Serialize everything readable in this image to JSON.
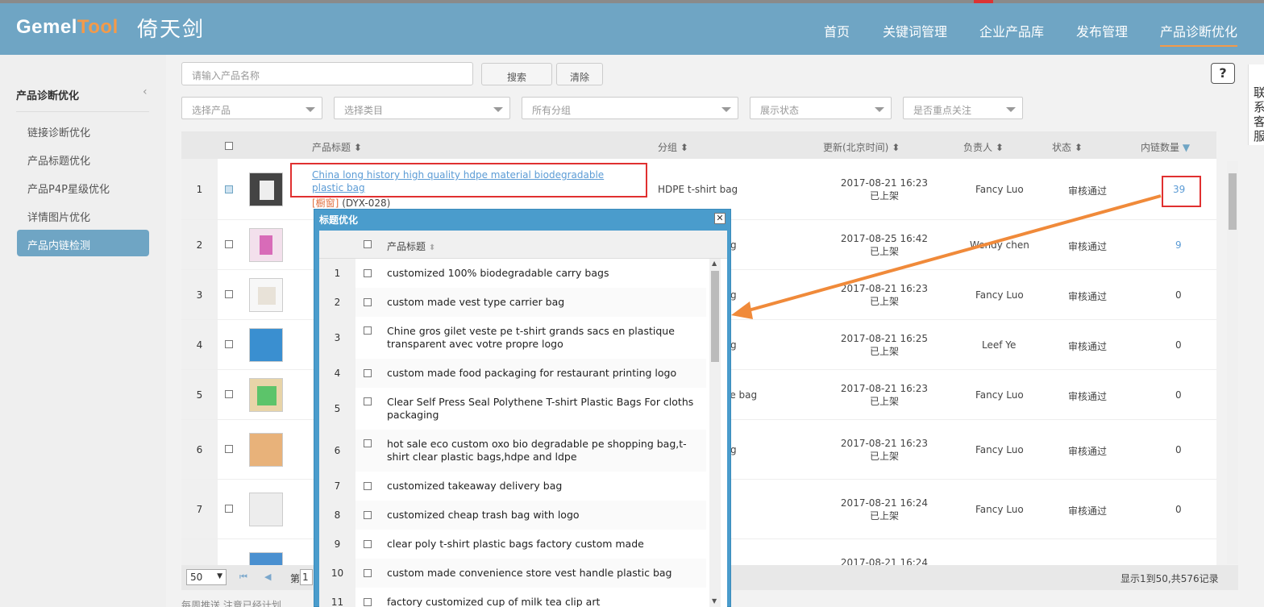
{
  "app": {
    "logo_main": "GemelTool",
    "logo_highlight": "Tool",
    "logo_cn": "倚天剑"
  },
  "nav": [
    "首页",
    "关键词管理",
    "企业产品库",
    "发布管理",
    "产品诊断优化"
  ],
  "sidebar": {
    "title": "产品诊断优化",
    "items": [
      "链接诊断优化",
      "产品标题优化",
      "产品P4P星级优化",
      "详情图片优化",
      "产品内链检测"
    ],
    "active_index": 4
  },
  "search": {
    "placeholder": "请输入产品名称",
    "search_label": "搜索",
    "clear_label": "清除"
  },
  "filters": [
    "选择产品",
    "选择类目",
    "所有分组",
    "展示状态",
    "是否重点关注"
  ],
  "help_label": "?",
  "side_tab": "联系客服",
  "table": {
    "columns": [
      "产品标题",
      "分组",
      "更新(北京时间)",
      "负责人",
      "状态",
      "内链数量"
    ],
    "rows": [
      {
        "num": "1",
        "checked": true,
        "title": "China long history high quality hdpe material biodegradable plastic bag",
        "tag": "[橱窗]",
        "code": "(DYX-028)",
        "group": "HDPE t-shirt bag",
        "date": "2017-08-21 16:23",
        "shelf": "已上架",
        "owner": "Fancy Luo",
        "status": "审核通过",
        "links": "39"
      },
      {
        "num": "2",
        "checked": false,
        "group": "g",
        "date": "2017-08-25 16:42",
        "shelf": "已上架",
        "owner": "Wendy chen",
        "status": "审核通过",
        "links": "9"
      },
      {
        "num": "3",
        "checked": false,
        "group": "g",
        "date": "2017-08-21 16:23",
        "shelf": "已上架",
        "owner": "Fancy Luo",
        "status": "审核通过",
        "links": "0"
      },
      {
        "num": "4",
        "checked": false,
        "group": "g",
        "date": "2017-08-21 16:25",
        "shelf": "已上架",
        "owner": "Leef Ye",
        "status": "审核通过",
        "links": "0"
      },
      {
        "num": "5",
        "checked": false,
        "group": "le bag",
        "date": "2017-08-21 16:23",
        "shelf": "已上架",
        "owner": "Fancy Luo",
        "status": "审核通过",
        "links": "0"
      },
      {
        "num": "6",
        "checked": false,
        "group": "g",
        "date": "2017-08-21 16:23",
        "shelf": "已上架",
        "owner": "Fancy Luo",
        "status": "审核通过",
        "links": "0"
      },
      {
        "num": "7",
        "checked": false,
        "group": "",
        "date": "2017-08-21 16:24",
        "shelf": "已上架",
        "owner": "Fancy Luo",
        "status": "审核通过",
        "links": "0"
      },
      {
        "num": "",
        "checked": false,
        "group": "",
        "date": "2017-08-21 16:24",
        "shelf": "",
        "owner": "",
        "status": "",
        "links": ""
      }
    ]
  },
  "footer": {
    "page_size": "50",
    "page_prefix": "第",
    "page_value": "1",
    "summary": "显示1到50,共576记录"
  },
  "bottom_text": "每周推送  注意已经计划",
  "modal": {
    "title": "标题优化",
    "column": "产品标题",
    "rows": [
      {
        "num": "1",
        "text": "customized 100% biodegradable carry bags"
      },
      {
        "num": "2",
        "text": "custom made vest type carrier bag"
      },
      {
        "num": "3",
        "text": "Chine gros gilet veste pe t-shirt grands sacs en plastique transparent avec votre propre logo"
      },
      {
        "num": "4",
        "text": "custom made food packaging for restaurant printing logo"
      },
      {
        "num": "5",
        "text": "Clear Self Press Seal Polythene T-shirt Plastic Bags For cloths packaging"
      },
      {
        "num": "6",
        "text": "hot sale eco custom oxo bio degradable pe shopping bag,t-shirt clear plastic bags,hdpe and ldpe"
      },
      {
        "num": "7",
        "text": "customized takeaway delivery bag"
      },
      {
        "num": "8",
        "text": "customized cheap trash bag with logo"
      },
      {
        "num": "9",
        "text": "clear poly t-shirt plastic bags factory custom made"
      },
      {
        "num": "10",
        "text": "custom made convenience store vest handle plastic bag"
      },
      {
        "num": "11",
        "text": "factory customized cup of milk tea clip art"
      }
    ]
  },
  "colors": {
    "header": "#6fa5c4",
    "accent": "#f39a4a",
    "highlight_box": "#e03030",
    "link": "#5b9bd5"
  }
}
